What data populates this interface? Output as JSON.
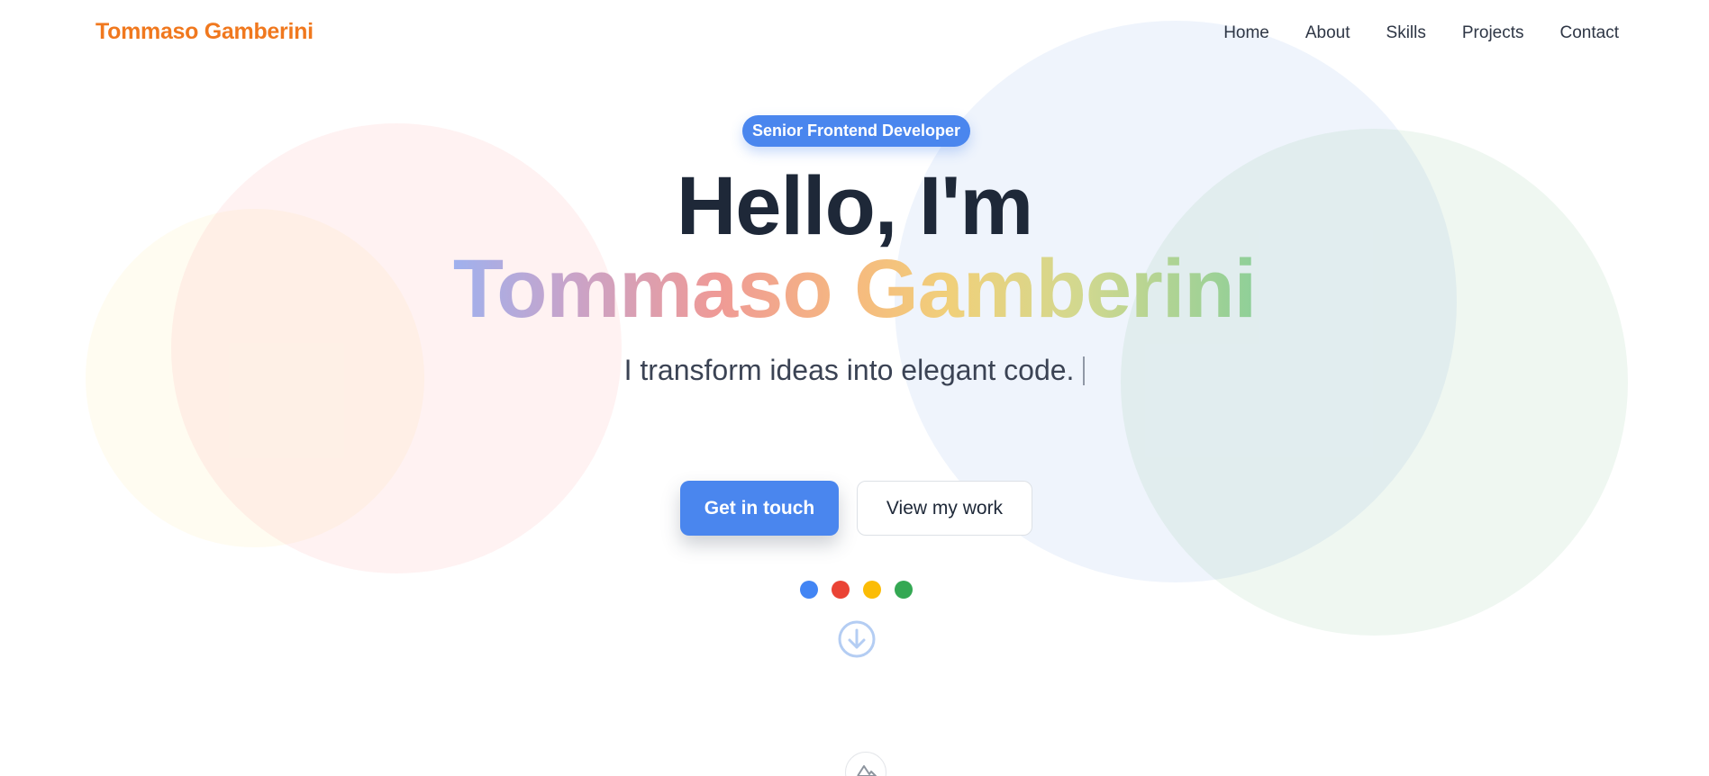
{
  "nav": {
    "brand": "Tommaso Gamberini",
    "links": [
      "Home",
      "About",
      "Skills",
      "Projects",
      "Contact"
    ]
  },
  "hero": {
    "badge": "Senior Frontend Developer",
    "greeting": "Hello, I'm",
    "name": "Tommaso Gamberini",
    "tagline": "I transform ideas into elegant code.",
    "primary_button": "Get in touch",
    "secondary_button": "View my work"
  },
  "dots": [
    {
      "name": "blue",
      "color": "#4285f4"
    },
    {
      "name": "red",
      "color": "#ea4335"
    },
    {
      "name": "yellow",
      "color": "#fbbc05"
    },
    {
      "name": "green",
      "color": "#34a853"
    }
  ],
  "colors": {
    "brand": "#f0781e",
    "accent": "#4a86ee",
    "text_dark": "#1e2838"
  },
  "icons": {
    "scroll": "arrow-down-circle-icon",
    "footer": "mountain-logo-icon"
  }
}
